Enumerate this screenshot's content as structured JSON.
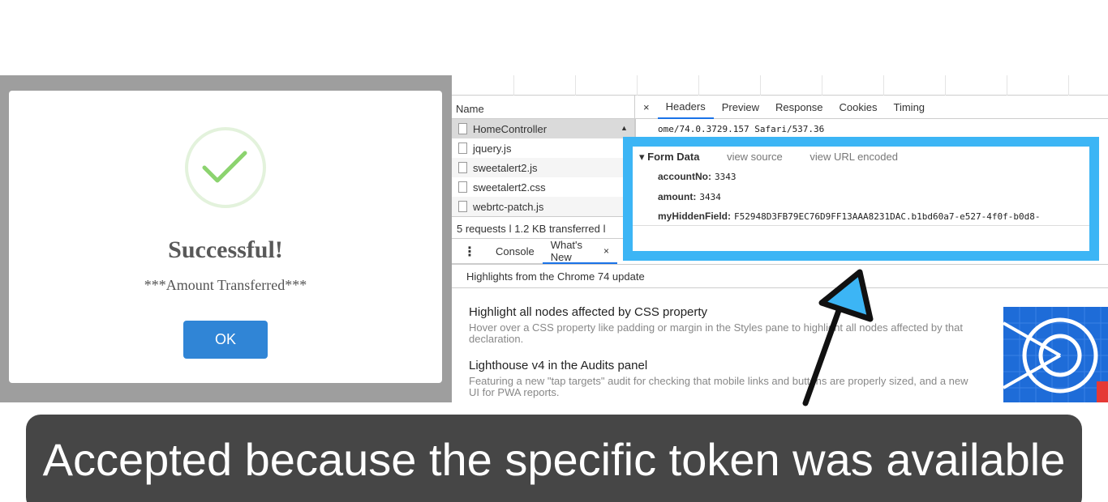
{
  "modal": {
    "title": "Successful!",
    "text": "***Amount Transferred***",
    "ok_label": "OK",
    "icon": "checkmark-icon",
    "accent_color": "#8cd36f",
    "button_color": "#3085d6"
  },
  "network": {
    "name_header": "Name",
    "files": [
      {
        "name": "HomeController"
      },
      {
        "name": "jquery.js"
      },
      {
        "name": "sweetalert2.js"
      },
      {
        "name": "sweetalert2.css"
      },
      {
        "name": "webrtc-patch.js"
      }
    ],
    "status": "5 requests  ǀ  1.2 KB transferred  ǀ"
  },
  "details": {
    "tabs": [
      "Headers",
      "Preview",
      "Response",
      "Cookies",
      "Timing"
    ],
    "user_agent_tail": "ome/74.0.3729.157 Safari/537.36",
    "form_data": {
      "label": "▾ Form Data",
      "view_source": "view source",
      "view_url_encoded": "view URL encoded",
      "fields": [
        {
          "key": "accountNo:",
          "value": "3343"
        },
        {
          "key": "amount:",
          "value": "3434"
        },
        {
          "key": "myHiddenField:",
          "value": "F52948D3FB79EC76D9FF13AAA8231DAC.b1bd60a7-e527-4f0f-b0d8-"
        }
      ]
    },
    "highlight_color": "#3cb5f5"
  },
  "drawer": {
    "tabs": [
      {
        "label": "Console"
      },
      {
        "label": "What's New",
        "close": "×"
      }
    ],
    "highlights_header": "Highlights from the Chrome 74 update",
    "items": [
      {
        "title": "Highlight all nodes affected by CSS property",
        "desc": "Hover over a CSS property like padding or margin in the Styles pane to highlight all nodes affected by that declaration."
      },
      {
        "title": "Lighthouse v4 in the Audits panel",
        "desc": "Featuring a new \"tap targets\" audit for checking that mobile links and buttons are properly sized, and a new UI for PWA reports."
      }
    ]
  },
  "caption": {
    "text": "Accepted because the specific token was available"
  }
}
